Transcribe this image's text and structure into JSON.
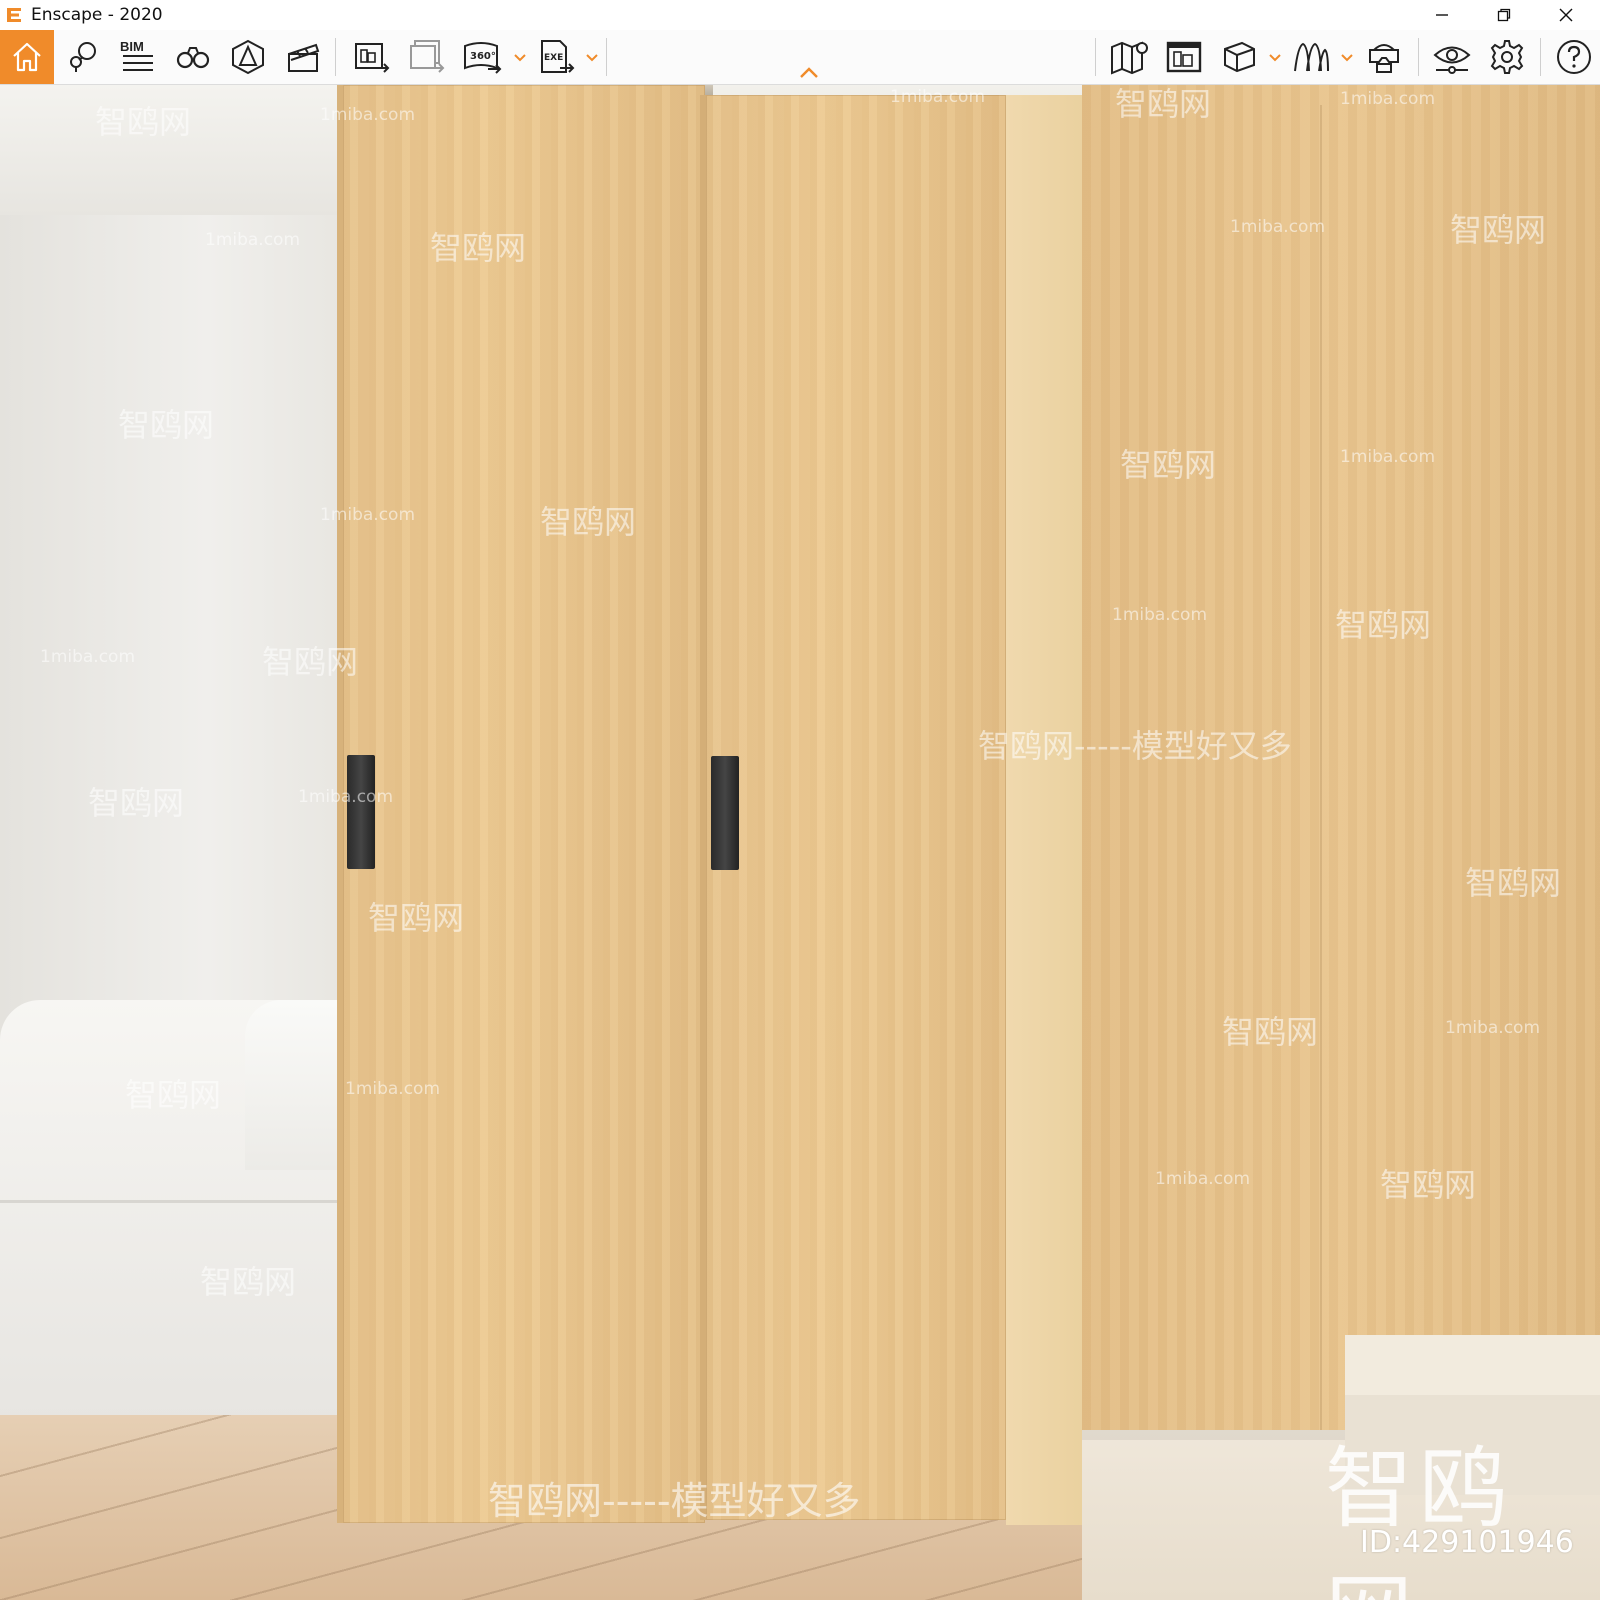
{
  "window": {
    "title": "Enscape - 2020",
    "accent_color": "#f08b2a"
  },
  "toolbar": {
    "bim_label": "BIM",
    "left_buttons": [
      {
        "name": "home",
        "icon": "home-icon"
      },
      {
        "name": "asset-library",
        "icon": "asset-library-icon"
      },
      {
        "name": "bim-mode",
        "icon": "bim-list-icon"
      },
      {
        "name": "views",
        "icon": "binoculars-icon"
      },
      {
        "name": "material-editor",
        "icon": "material-icon"
      },
      {
        "name": "video-editor",
        "icon": "clapperboard-icon"
      },
      {
        "name": "render-screenshot",
        "icon": "screenshot-export-icon"
      },
      {
        "name": "batch-render",
        "icon": "batch-render-icon"
      },
      {
        "name": "panorama",
        "icon": "panorama-360-icon",
        "label": "360°"
      },
      {
        "name": "export-exe",
        "icon": "export-exe-icon",
        "label": "EXE"
      }
    ],
    "right_buttons": [
      {
        "name": "map",
        "icon": "map-icon"
      },
      {
        "name": "capture-view",
        "icon": "capture-view-icon"
      },
      {
        "name": "orthographic",
        "icon": "cube-icon"
      },
      {
        "name": "atmosphere",
        "icon": "atmosphere-icon"
      },
      {
        "name": "vr-headset",
        "icon": "vr-headset-icon"
      },
      {
        "name": "visual-settings",
        "icon": "eye-icon"
      },
      {
        "name": "settings",
        "icon": "gear-icon"
      },
      {
        "name": "help",
        "icon": "help-icon"
      }
    ]
  },
  "watermark": {
    "site": "1miba.com",
    "brand": "智鸥网",
    "slogan": "智鸥网-----模型好又多",
    "big_brand": "智鸥网",
    "id_text": "ID:429101946"
  }
}
